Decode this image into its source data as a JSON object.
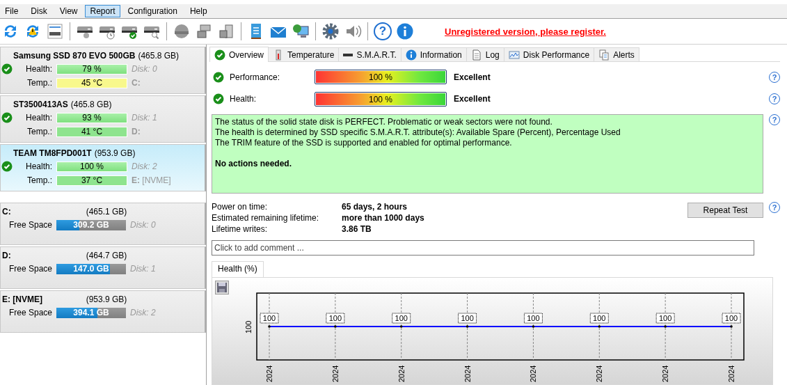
{
  "menu": [
    {
      "label": "File",
      "selected": false
    },
    {
      "label": "Disk",
      "selected": false
    },
    {
      "label": "View",
      "selected": false
    },
    {
      "label": "Report",
      "selected": true
    },
    {
      "label": "Configuration",
      "selected": false
    },
    {
      "label": "Help",
      "selected": false
    }
  ],
  "register_link": "Unregistered version, please register.",
  "toolbar_help": "?",
  "disks": [
    {
      "name": "Samsung SSD 870 EVO 500GB",
      "size": "(465.8 GB)",
      "health_label": "Health:",
      "health": "79 %",
      "disk": "Disk: 0",
      "temp_label": "Temp.:",
      "temp": {
        "text": "45 °C",
        "color": "#f8f88c"
      },
      "drive": "C:",
      "selected": false
    },
    {
      "name": "ST3500413AS",
      "size": "(465.8 GB)",
      "health_label": "Health:",
      "health": "93 %",
      "disk": "Disk: 1",
      "temp_label": "Temp.:",
      "temp": {
        "text": "41 °C",
        "color": "#8ee48e"
      },
      "drive": "D:",
      "selected": false
    },
    {
      "name": "TEAM TM8FPD001T",
      "size": "(953.9 GB)",
      "health_label": "Health:",
      "health": "100 %",
      "disk": "Disk: 2",
      "temp_label": "Temp.:",
      "temp": {
        "text": "37 °C",
        "color": "#8ee48e"
      },
      "drive": "E:",
      "drive_extra": "[NVME]",
      "selected": true
    }
  ],
  "volumes": [
    {
      "name": "C:",
      "size": "(465.1 GB)",
      "label": "Free Space",
      "free": "309.2 GB",
      "level": 0.33,
      "disk": "Disk: 0"
    },
    {
      "name": "D:",
      "size": "(464.7 GB)",
      "label": "Free Space",
      "free": "147.0 GB",
      "level": 0.77,
      "disk": "Disk: 1"
    },
    {
      "name": "E: [NVME]",
      "size": "(953.9 GB)",
      "label": "Free Space",
      "free": "394.1 GB",
      "level": 0.59,
      "disk": "Disk: 2"
    }
  ],
  "tabs": [
    {
      "label": "Overview",
      "kind": "check",
      "selected": true
    },
    {
      "label": "Temperature",
      "kind": "thermometer",
      "selected": false
    },
    {
      "label": "S.M.A.R.T.",
      "kind": "drive",
      "selected": false
    },
    {
      "label": "Information",
      "kind": "info",
      "selected": false
    },
    {
      "label": "Log",
      "kind": "document",
      "selected": false
    },
    {
      "label": "Disk Performance",
      "kind": "graph",
      "selected": false
    },
    {
      "label": "Alerts",
      "kind": "pages",
      "selected": false
    }
  ],
  "metrics": [
    {
      "label": "Performance:",
      "level": 1.0,
      "reading": "100 %",
      "rating": "Excellent"
    },
    {
      "label": "Health:",
      "level": 1.0,
      "reading": "100 %",
      "rating": "Excellent"
    }
  ],
  "help_marks": [
    "?",
    "?",
    "?",
    "?"
  ],
  "status_lines": [
    "The status of the solid state disk is PERFECT. Problematic or weak sectors were not found.",
    "The health is determined by SSD specific S.M.A.R.T. attribute(s):  Available Spare (Percent), Percentage Used",
    "The TRIM feature of the SSD is supported and enabled for optimal performance."
  ],
  "status_action": "No actions needed.",
  "details": [
    {
      "label": "Power on time:",
      "value": "65 days, 2 hours"
    },
    {
      "label": "Estimated remaining lifetime:",
      "value": "more than 1000 days"
    },
    {
      "label": "Lifetime writes:",
      "value": "3.86 TB"
    }
  ],
  "repeat_button": "Repeat Test",
  "comment": {
    "placeholder": "Click to add comment ..."
  },
  "health_chart": {
    "tab": "Health (%)",
    "y_label": "100",
    "points": [
      {
        "value": "100",
        "date": "2024"
      },
      {
        "value": "100",
        "date": "2024"
      },
      {
        "value": "100",
        "date": "2024"
      },
      {
        "value": "100",
        "date": "2024"
      },
      {
        "value": "100",
        "date": "2024"
      },
      {
        "value": "100",
        "date": "2024"
      },
      {
        "value": "100",
        "date": "2024"
      },
      {
        "value": "100",
        "date": "2024"
      }
    ]
  }
}
